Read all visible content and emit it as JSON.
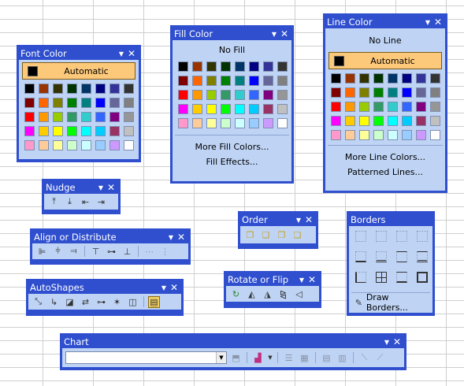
{
  "font_color": {
    "title": "Font Color",
    "automatic_label": "Automatic"
  },
  "fill_color": {
    "title": "Fill Color",
    "no_fill_label": "No Fill",
    "more_label": "More Fill Colors...",
    "effects_label": "Fill Effects..."
  },
  "line_color": {
    "title": "Line Color",
    "no_line_label": "No Line",
    "automatic_label": "Automatic",
    "more_label": "More Line Colors...",
    "patterned_label": "Patterned Lines..."
  },
  "palette_colors": [
    [
      "#000000",
      "#993300",
      "#333300",
      "#003300",
      "#003366",
      "#000080",
      "#333399",
      "#333333"
    ],
    [
      "#800000",
      "#ff6600",
      "#808000",
      "#008000",
      "#008080",
      "#0000ff",
      "#666699",
      "#808080"
    ],
    [
      "#ff0000",
      "#ff9900",
      "#99cc00",
      "#339966",
      "#33cccc",
      "#3366ff",
      "#800080",
      "#969696"
    ],
    [
      "#ff00ff",
      "#ffcc00",
      "#ffff00",
      "#00ff00",
      "#00ffff",
      "#00ccff",
      "#993366",
      "#c0c0c0"
    ],
    [
      "#ff99cc",
      "#ffcc99",
      "#ffff99",
      "#ccffcc",
      "#ccffff",
      "#99ccff",
      "#cc99ff",
      "#ffffff"
    ]
  ],
  "nudge": {
    "title": "Nudge"
  },
  "align": {
    "title": "Align or Distribute"
  },
  "autoshapes": {
    "title": "AutoShapes"
  },
  "order": {
    "title": "Order"
  },
  "rotate": {
    "title": "Rotate or Flip"
  },
  "borders": {
    "title": "Borders",
    "draw_label": "Draw Borders..."
  },
  "chart": {
    "title": "Chart"
  },
  "icons": {
    "dropdown": "▼",
    "close": "✕"
  }
}
